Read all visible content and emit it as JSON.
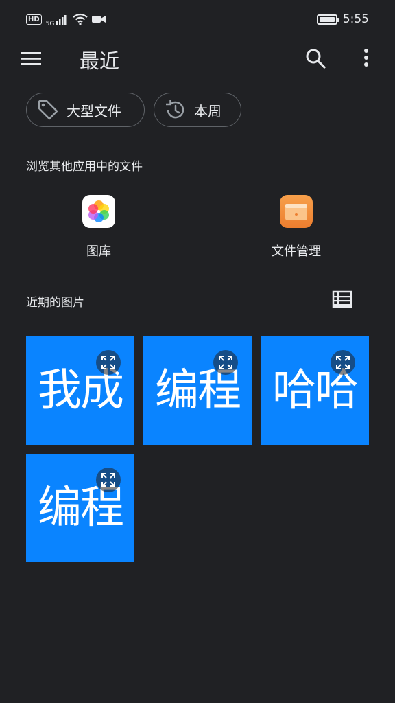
{
  "status": {
    "hd": "HD",
    "network": "5G",
    "time": "5:55"
  },
  "toolbar": {
    "title": "最近"
  },
  "chips": [
    {
      "label": "大型文件",
      "icon": "tag-icon"
    },
    {
      "label": "本周",
      "icon": "history-icon"
    }
  ],
  "browse": {
    "label": "浏览其他应用中的文件",
    "apps": [
      {
        "label": "图库",
        "icon": "gallery-icon"
      },
      {
        "label": "文件管理",
        "icon": "file-manager-icon"
      }
    ]
  },
  "recent": {
    "label": "近期的图片",
    "images": [
      {
        "text": "我成"
      },
      {
        "text": "编程"
      },
      {
        "text": "哈哈"
      },
      {
        "text": "编程"
      }
    ]
  },
  "colors": {
    "background": "#202124",
    "thumbnail": "#0a84ff",
    "text": "#e8eaed"
  }
}
